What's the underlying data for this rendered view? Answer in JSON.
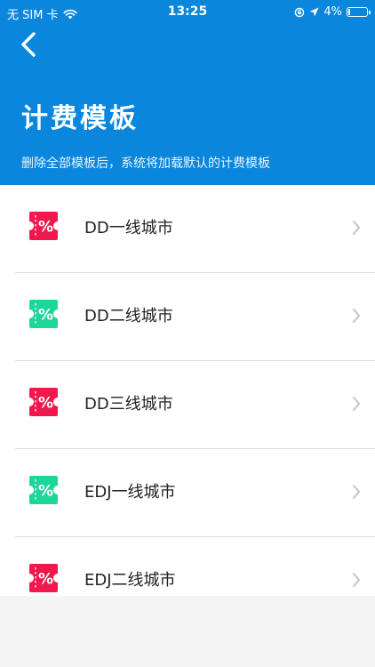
{
  "status_bar": {
    "carrier": "无 SIM 卡",
    "time": "13:25",
    "battery_percent": "4%",
    "battery_level": 0.04,
    "icons": [
      "wifi-icon",
      "orientation-lock-icon",
      "location-arrow-icon",
      "battery-icon"
    ]
  },
  "header": {
    "title": "计费模板",
    "subtitle": "删除全部模板后，系统将加载默认的计费模板",
    "background_color": "#0a86dd"
  },
  "templates": [
    {
      "label": "DD一线城市",
      "icon": "coupon-percent-icon",
      "icon_color": "#f0184c"
    },
    {
      "label": "DD二线城市",
      "icon": "coupon-percent-icon",
      "icon_color": "#1ed69a"
    },
    {
      "label": "DD三线城市",
      "icon": "coupon-percent-icon",
      "icon_color": "#f0184c"
    },
    {
      "label": "EDJ一线城市",
      "icon": "coupon-percent-icon",
      "icon_color": "#1ed69a"
    },
    {
      "label": "EDJ二线城市",
      "icon": "coupon-percent-icon",
      "icon_color": "#f0184c"
    }
  ]
}
